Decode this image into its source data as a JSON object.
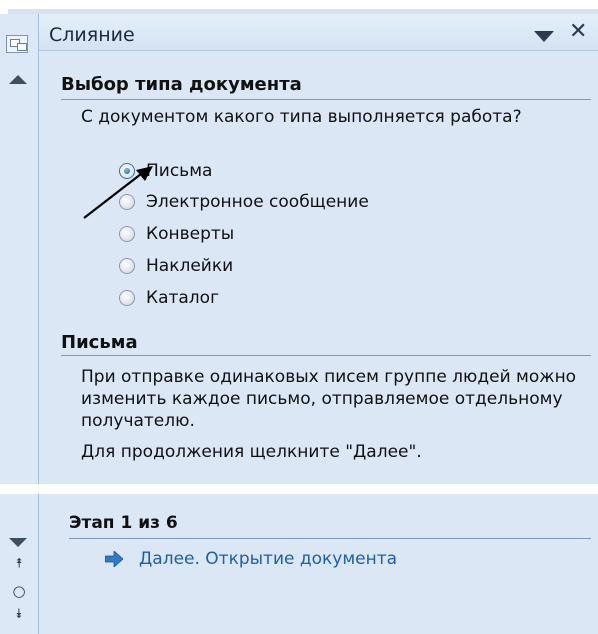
{
  "task_pane": {
    "title": "Слияние",
    "section1": {
      "heading": "Выбор типа документа",
      "question": "С документом какого типа выполняется работа?",
      "options": [
        {
          "label": "Письма",
          "checked": true
        },
        {
          "label": "Электронное сообщение",
          "checked": false
        },
        {
          "label": "Конверты",
          "checked": false
        },
        {
          "label": "Наклейки",
          "checked": false
        },
        {
          "label": "Каталог",
          "checked": false
        }
      ]
    },
    "section2": {
      "heading": "Письма",
      "description": "При отправке одинаковых писем группе людей можно изменить каждое письмо, отправляемое отдельному получателю.",
      "hint": "Для продолжения щелкните \"Далее\"."
    }
  },
  "wizard_footer": {
    "step_label": "Этап 1 из 6",
    "next_link": "Далее. Открытие документа"
  },
  "icons": {
    "pane_menu": "chevron-down-icon",
    "close": "close-icon",
    "next": "arrow-right-icon"
  },
  "colors": {
    "pane_background": "#dbe7f5",
    "link": "#1d5fa8",
    "accent_radio": "#1e5f93"
  }
}
